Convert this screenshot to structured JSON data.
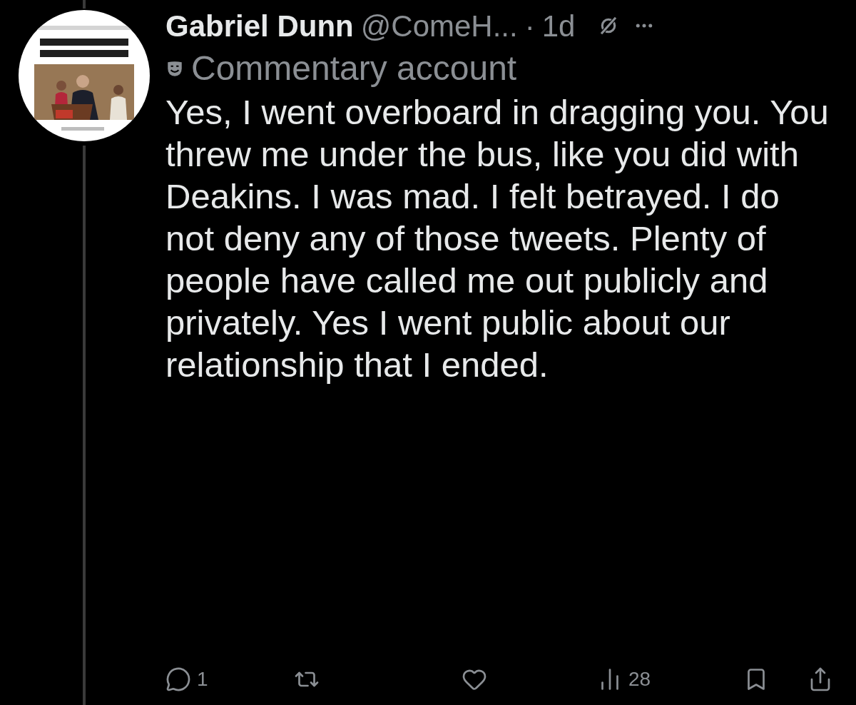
{
  "tweet": {
    "name": "Gabriel Dunn",
    "handle": "@ComeH...",
    "separator": "·",
    "time": "1d",
    "label": "Commentary account",
    "text": "Yes, I went overboard in dragging you. You threw me under the bus, like you did with Deakins. I was mad. I felt betrayed. I do not deny any of those tweets. Plenty of people have called me out publicly and privately. Yes I went public about our relationship that I ended."
  },
  "actions": [
    {
      "kind": "reply",
      "count": "1"
    },
    {
      "kind": "retweet"
    },
    {
      "kind": "like"
    },
    {
      "kind": "views",
      "count": "28"
    },
    {
      "kind": "bookmark"
    },
    {
      "kind": "share"
    }
  ]
}
